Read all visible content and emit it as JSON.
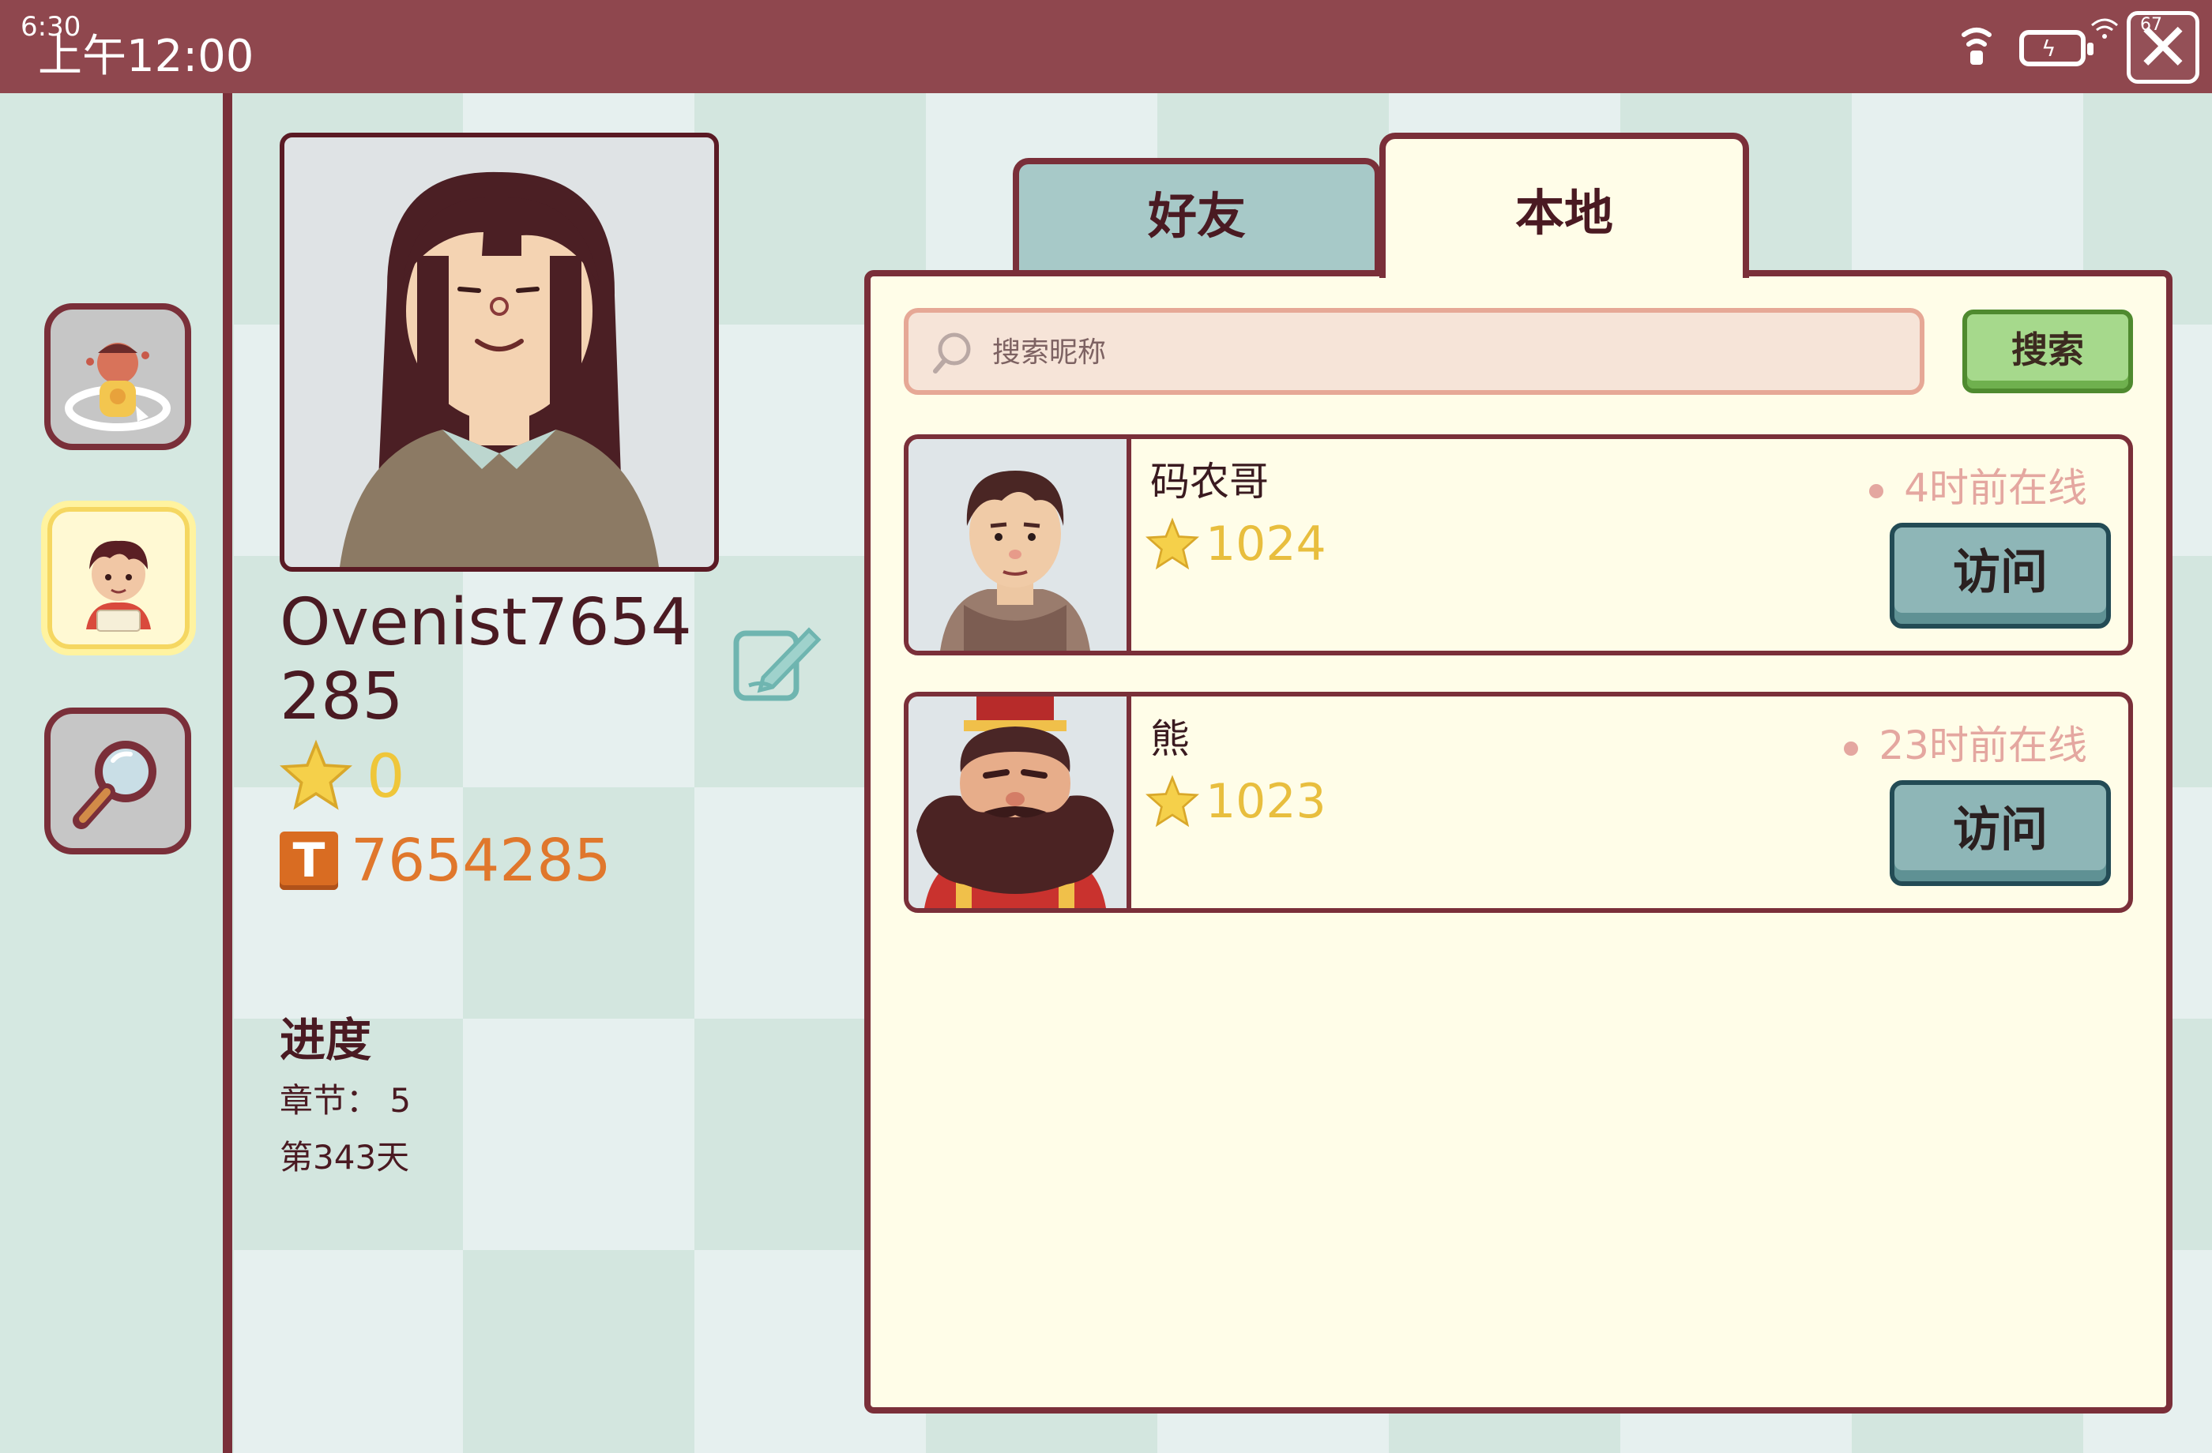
{
  "status_bar": {
    "time_small": "6:30",
    "time": "上午12:00",
    "battery_level": "67"
  },
  "sidebar": {
    "items": [
      {
        "name": "cook-mode",
        "active": false
      },
      {
        "name": "profile",
        "active": true
      },
      {
        "name": "search",
        "active": false
      }
    ]
  },
  "profile": {
    "username": "Ovenist7654285",
    "stars": "0",
    "coins": "7654285",
    "coin_letter": "T",
    "progress_title": "进度",
    "chapter": "章节：  5",
    "day": "第343天"
  },
  "tabs": [
    {
      "label": "好友",
      "active": false
    },
    {
      "label": "本地",
      "active": true
    }
  ],
  "search": {
    "placeholder": "搜索昵称",
    "value": "",
    "button_label": "搜索"
  },
  "friends": [
    {
      "name": "码农哥",
      "score": "1024",
      "online": "4时前在线",
      "visit_label": "访问"
    },
    {
      "name": "熊",
      "score": "1023",
      "online": "23时前在线",
      "visit_label": "访问"
    }
  ],
  "colors": {
    "top_bar": "#8f474e",
    "border": "#7a2f39",
    "panel": "#fffde8",
    "star": "#efc63a",
    "coin": "#d96c22",
    "search_button": "#a6d98c",
    "visit_button": "#8eb6b7"
  }
}
